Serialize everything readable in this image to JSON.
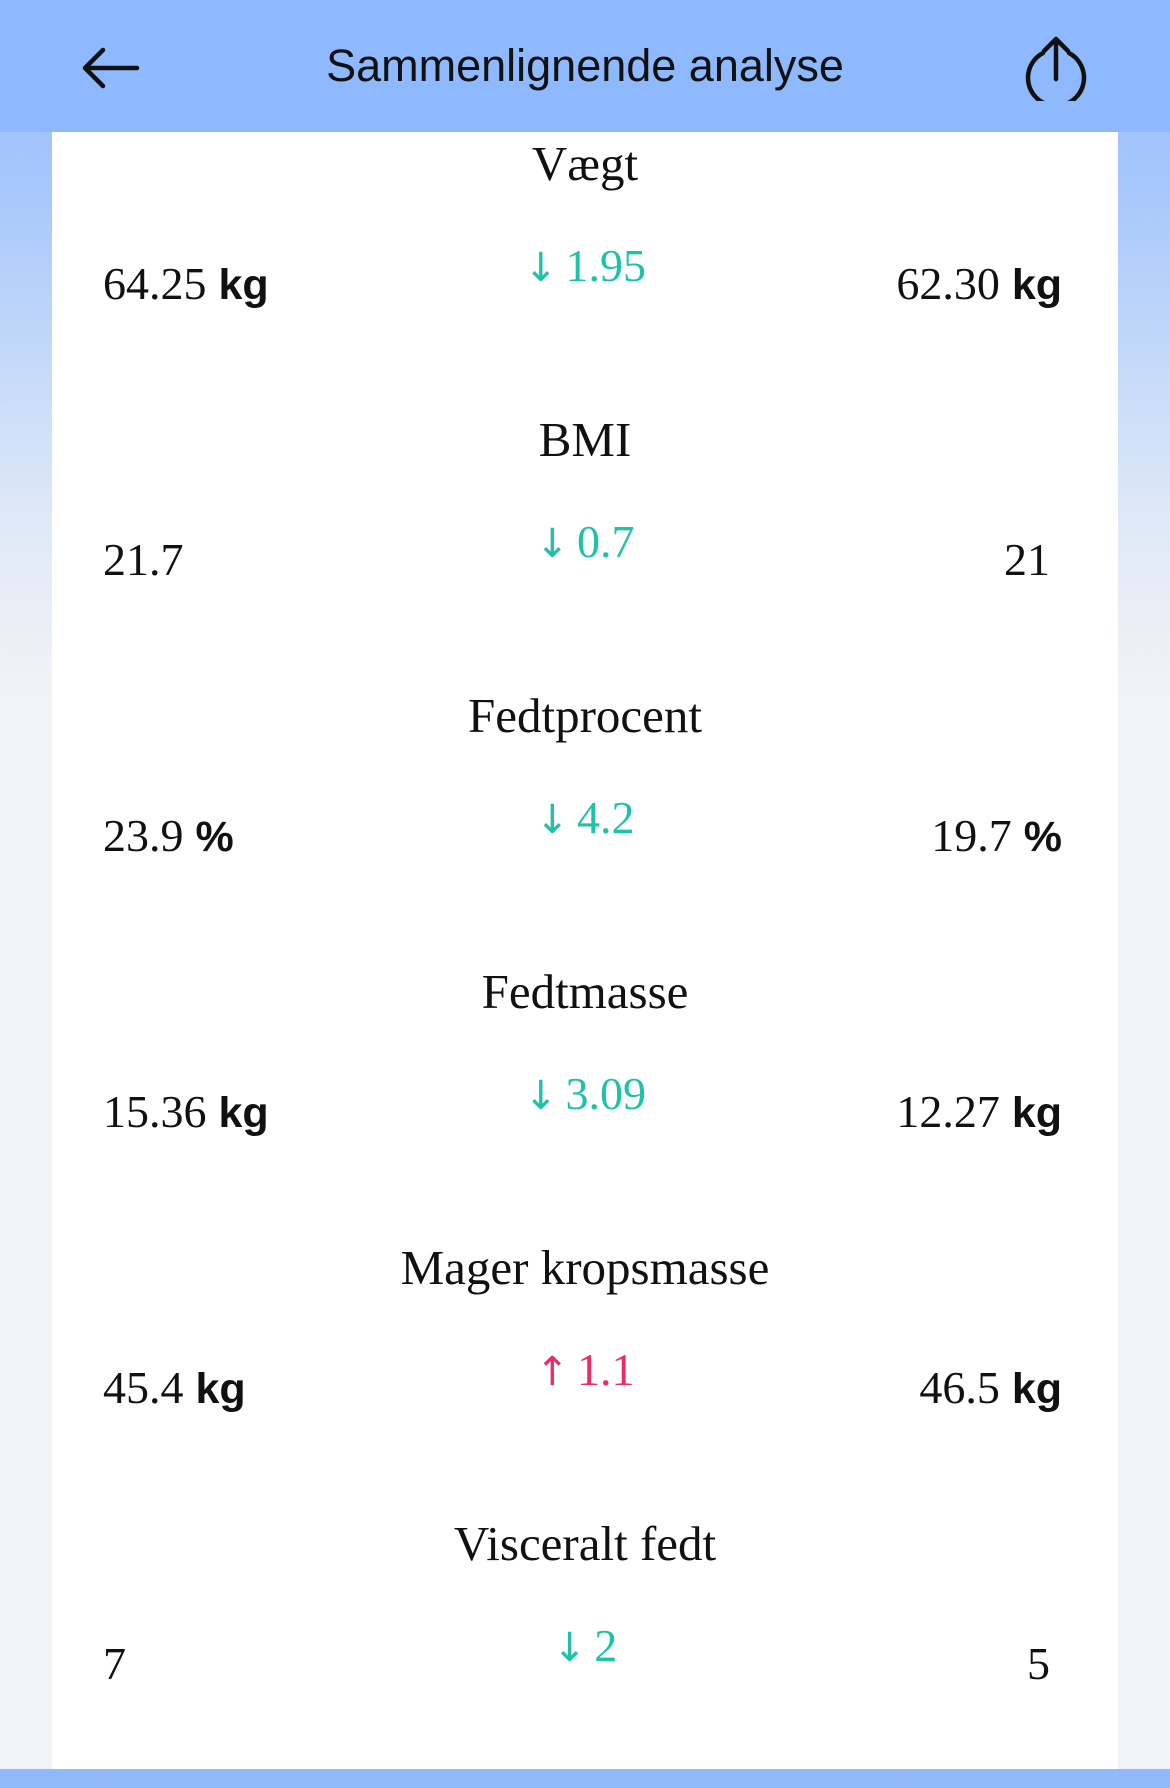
{
  "header": {
    "title": "Sammenlignende analyse",
    "back_icon": "arrow-left-icon",
    "share_icon": "share-upload-icon",
    "background_color": "#8fb9fe"
  },
  "colors": {
    "decrease": "#1dc3a8",
    "increase": "#ee2a6a"
  },
  "metrics": [
    {
      "name": "Vægt",
      "before": "64.25",
      "before_unit": "kg",
      "arrow": "↓",
      "delta": "1.95",
      "after": "62.30",
      "after_unit": "kg",
      "direction": "down"
    },
    {
      "name": "BMI",
      "before": "21.7",
      "before_unit": "",
      "arrow": "↓",
      "delta": "0.7",
      "after": "21",
      "after_unit": "",
      "direction": "down"
    },
    {
      "name": "Fedtprocent",
      "before": "23.9",
      "before_unit": "%",
      "arrow": "↓",
      "delta": "4.2",
      "after": "19.7",
      "after_unit": "%",
      "direction": "down"
    },
    {
      "name": "Fedtmasse",
      "before": "15.36",
      "before_unit": "kg",
      "arrow": "↓",
      "delta": "3.09",
      "after": "12.27",
      "after_unit": "kg",
      "direction": "down"
    },
    {
      "name": "Mager kropsmasse",
      "before": "45.4",
      "before_unit": "kg",
      "arrow": "↑",
      "delta": "1.1",
      "after": "46.5",
      "after_unit": "kg",
      "direction": "up"
    },
    {
      "name": "Visceralt fedt",
      "before": "7",
      "before_unit": "",
      "arrow": "↓",
      "delta": "2",
      "after": "5",
      "after_unit": "",
      "direction": "down"
    }
  ]
}
